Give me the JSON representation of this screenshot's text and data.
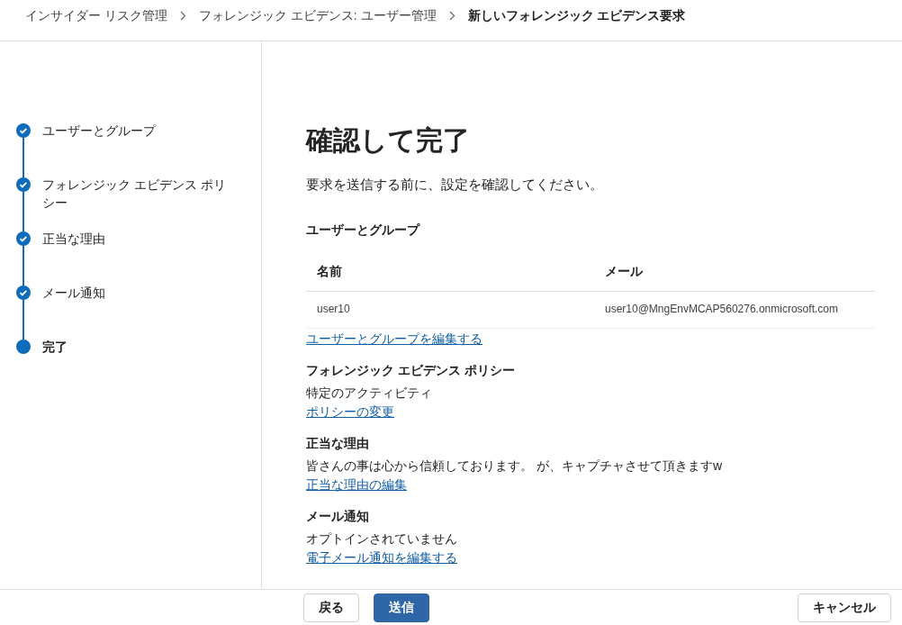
{
  "breadcrumb": [
    {
      "label": "インサイダー リスク管理",
      "current": false
    },
    {
      "label": "フォレンジック エビデンス: ユーザー管理",
      "current": false
    },
    {
      "label": "新しいフォレンジック エビデンス要求",
      "current": true
    }
  ],
  "steps": [
    {
      "label": "ユーザーとグループ",
      "completed": true,
      "selected": false
    },
    {
      "label": "フォレンジック エビデンス ポリシー",
      "completed": true,
      "selected": false
    },
    {
      "label": "正当な理由",
      "completed": true,
      "selected": false
    },
    {
      "label": "メール通知",
      "completed": true,
      "selected": false
    },
    {
      "label": "完了",
      "completed": false,
      "selected": true
    }
  ],
  "page": {
    "title": "確認して完了",
    "intro": "要求を送信する前に、設定を確認してください。"
  },
  "sections": [
    {
      "heading": "ユーザーとグループ",
      "table": {
        "columns": [
          "名前",
          "メール"
        ],
        "rows": [
          [
            "user10",
            "user10@MngEnvMCAP560276.onmicrosoft.com"
          ]
        ]
      },
      "link": "ユーザーとグループを編集する"
    },
    {
      "heading": "フォレンジック エビデンス ポリシー",
      "text": "特定のアクティビティ",
      "link": "ポリシーの変更"
    },
    {
      "heading": "正当な理由",
      "text": "皆さんの事は心から信頼しております。 が、キャプチャさせて頂きますw",
      "link": "正当な理由の編集"
    },
    {
      "heading": "メール通知",
      "text": "オプトインされていません",
      "link": "電子メール通知を編集する"
    }
  ],
  "footer": {
    "back": "戻る",
    "submit": "送信",
    "cancel": "キャンセル"
  }
}
